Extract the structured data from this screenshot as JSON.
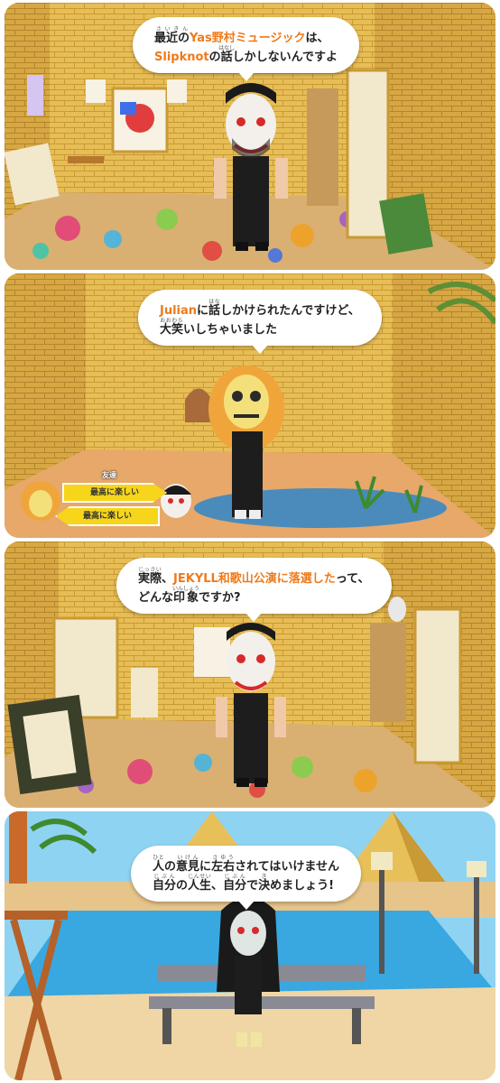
{
  "panels": [
    {
      "bubble": {
        "line1": [
          {
            "text": "最近の",
            "ruby": "さいきん"
          },
          {
            "text": "Yas野村ミュージック",
            "hl": true
          },
          {
            "text": "は、"
          }
        ],
        "line2": [
          {
            "text": "Slipknot",
            "hl": true
          },
          {
            "text": "の"
          },
          {
            "text": "話",
            "ruby": "はなし"
          },
          {
            "text": "しかしないんですよ"
          }
        ]
      }
    },
    {
      "bubble": {
        "line1": [
          {
            "text": "Julian",
            "hl": true
          },
          {
            "text": "に"
          },
          {
            "text": "話",
            "ruby": "はな"
          },
          {
            "text": "しかけられたんですけど、"
          }
        ],
        "line2": [
          {
            "text": "大笑",
            "ruby": "おおわら"
          },
          {
            "text": "いしちゃいました"
          }
        ]
      },
      "friend": {
        "label": "友達",
        "to_right": "最高に楽しい",
        "to_left": "最高に楽しい"
      }
    },
    {
      "bubble": {
        "line1": [
          {
            "text": "実際",
            "ruby": "じっさい"
          },
          {
            "text": "、"
          },
          {
            "text": "JEKYLL和歌山公演に落選した",
            "hl": true
          },
          {
            "text": "って、"
          }
        ],
        "line2": [
          {
            "text": "どんな"
          },
          {
            "text": "印象",
            "ruby": "いんしょう"
          },
          {
            "text": "ですか?"
          }
        ]
      }
    },
    {
      "bubble": {
        "line1": [
          {
            "text": "人",
            "ruby": "ひと"
          },
          {
            "text": "の"
          },
          {
            "text": "意見",
            "ruby": "いけん"
          },
          {
            "text": "に"
          },
          {
            "text": "左右",
            "ruby": "さゆう"
          },
          {
            "text": "されてはいけません"
          }
        ],
        "line2": [
          {
            "text": "自分",
            "ruby": "じぶん"
          },
          {
            "text": "の"
          },
          {
            "text": "人生",
            "ruby": "じんせい"
          },
          {
            "text": "、"
          },
          {
            "text": "自分",
            "ruby": "じぶん"
          },
          {
            "text": "で"
          },
          {
            "text": "決",
            "ruby": "き"
          },
          {
            "text": "めましょう!"
          }
        ]
      }
    }
  ],
  "colors": {
    "highlight": "#ef7a1a",
    "arrow": "#f6d51a",
    "wall": "#e8c05a",
    "sea": "#39a7e0",
    "sky": "#8fd3f2"
  }
}
